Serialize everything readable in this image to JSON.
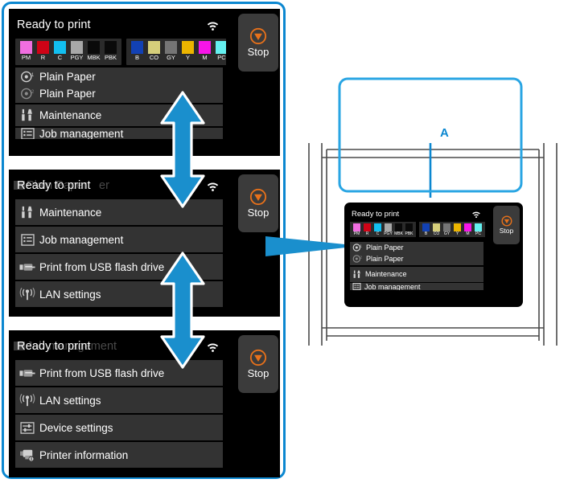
{
  "document": {
    "type": "printer-manual-illustration",
    "callout_label": "A",
    "accent_color": "#0b87d0"
  },
  "panel_common": {
    "status_title": "Ready to print",
    "stop_button_label": "Stop",
    "wifi_icon": "wifi-icon",
    "stop_icon": "stop-octagon-icon",
    "stop_icon_color": "#e8711a"
  },
  "ink_tanks": {
    "group_left": [
      {
        "label": "PM",
        "color": "#f06ee0"
      },
      {
        "label": "R",
        "color": "#cf0316"
      },
      {
        "label": "C",
        "color": "#12bff0"
      },
      {
        "label": "PGY",
        "color": "#a8a8a8"
      },
      {
        "label": "MBK",
        "color": "#0a0a0a"
      },
      {
        "label": "PBK",
        "color": "#0a0a0a"
      }
    ],
    "group_right": [
      {
        "label": "B",
        "color": "#1241b4"
      },
      {
        "label": "CO",
        "color": "#d6cf7b"
      },
      {
        "label": "GY",
        "color": "#757575"
      },
      {
        "label": "Y",
        "color": "#ecb500"
      },
      {
        "label": "M",
        "color": "#f715e8"
      },
      {
        "label": "PC",
        "color": "#64f0f0"
      }
    ]
  },
  "panels": [
    {
      "name": "panel-top",
      "ghost_text": "",
      "scroll_dots_active": [
        0,
        1
      ],
      "rows": [
        {
          "type": "paper",
          "icon": "paper-roll-icon",
          "lines": [
            {
              "icon": "paper-roll-1-icon",
              "label": "Plain Paper"
            },
            {
              "icon": "paper-roll-2-icon",
              "label": "Plain Paper"
            }
          ]
        },
        {
          "type": "menu",
          "icon": "maintenance-icon",
          "label": "Maintenance"
        },
        {
          "type": "menu-clipped",
          "icon": "job-management-icon",
          "label": "Job management"
        }
      ]
    },
    {
      "name": "panel-middle",
      "ghost_text": "Plain Paper",
      "ghost_suffix": "er",
      "scroll_dots_active": [
        0,
        1
      ],
      "rows": [
        {
          "type": "menu",
          "icon": "maintenance-icon",
          "label": "Maintenance"
        },
        {
          "type": "menu",
          "icon": "job-management-icon",
          "label": "Job management"
        },
        {
          "type": "menu",
          "icon": "usb-icon",
          "label": "Print from USB flash drive"
        },
        {
          "type": "menu",
          "icon": "lan-icon",
          "label": "LAN settings"
        }
      ]
    },
    {
      "name": "panel-bottom",
      "ghost_text": "Job management",
      "ghost_suffix": "",
      "scroll_dots_active": [
        4,
        5,
        6,
        7
      ],
      "rows": [
        {
          "type": "menu",
          "icon": "usb-icon",
          "label": "Print from USB flash drive"
        },
        {
          "type": "menu",
          "icon": "lan-icon",
          "label": "LAN settings"
        },
        {
          "type": "menu",
          "icon": "device-settings-icon",
          "label": "Device settings"
        },
        {
          "type": "menu",
          "icon": "printer-info-icon",
          "label": "Printer information"
        }
      ]
    }
  ],
  "illustration": {
    "name": "printer-front-line-art",
    "highlight_border_color": "#29a5e3",
    "callout": {
      "label": "A",
      "leader": "vertical-line"
    },
    "mini_panel": {
      "status_title": "Ready to print",
      "stop_button_label": "Stop",
      "rows": [
        {
          "icon": "paper-roll-1-icon",
          "label": "Plain Paper"
        },
        {
          "icon": "paper-roll-2-icon",
          "label": "Plain Paper"
        },
        {
          "icon": "maintenance-icon",
          "label": "Maintenance"
        },
        {
          "icon": "job-management-icon",
          "label": "Job management"
        }
      ]
    }
  },
  "arrows": {
    "vertical_1": "double-headed-vertical-arrow",
    "vertical_2": "double-headed-vertical-arrow",
    "horizontal": "right-pointing-arrow",
    "color": "#1a8fcd"
  }
}
